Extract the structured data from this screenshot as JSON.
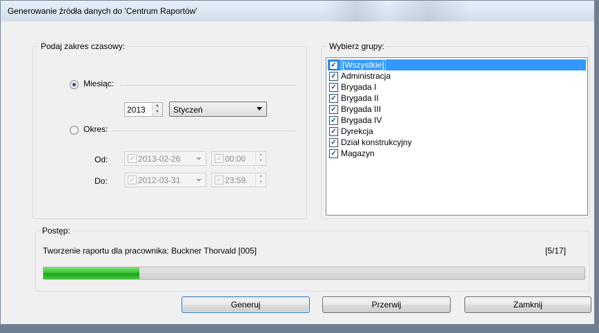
{
  "window": {
    "title": "Generowanie źródła danych do 'Centrum Raportów'"
  },
  "time_range": {
    "caption": "Podaj zakres czasowy:",
    "month_option": {
      "label": "Miesiąc:",
      "checked": true
    },
    "year": "2013",
    "month": "Styczeń",
    "period_option": {
      "label": "Okres:",
      "checked": false
    },
    "from": {
      "label": "Od:",
      "date": "2013-02-26",
      "time": "00:00"
    },
    "to": {
      "label": "Do:",
      "date": "2012-03-31",
      "time": "23:59"
    }
  },
  "groups": {
    "caption": "Wybierz grupy:",
    "items": [
      {
        "label": "[Wszystkie]",
        "checked": true,
        "selected": true
      },
      {
        "label": "Administracja",
        "checked": true
      },
      {
        "label": "Brygada I",
        "checked": true
      },
      {
        "label": "Brygada II",
        "checked": true
      },
      {
        "label": "Brygada III",
        "checked": true
      },
      {
        "label": "Brygada IV",
        "checked": true
      },
      {
        "label": "Dyrekcja",
        "checked": true
      },
      {
        "label": "Dział konstrukcyjny",
        "checked": true
      },
      {
        "label": "Magazyn",
        "checked": true
      }
    ]
  },
  "progress": {
    "caption": "Postęp:",
    "status": "Tworzenie raportu dla pracownika: Buckner Thorvald [005]",
    "counter": "[5/17]",
    "fraction": 0.177
  },
  "buttons": {
    "generate": "Generuj",
    "stop": "Przerwij",
    "close": "Zamknij"
  },
  "colors": {
    "selection": "#3399ff",
    "progress": "#37c232"
  }
}
